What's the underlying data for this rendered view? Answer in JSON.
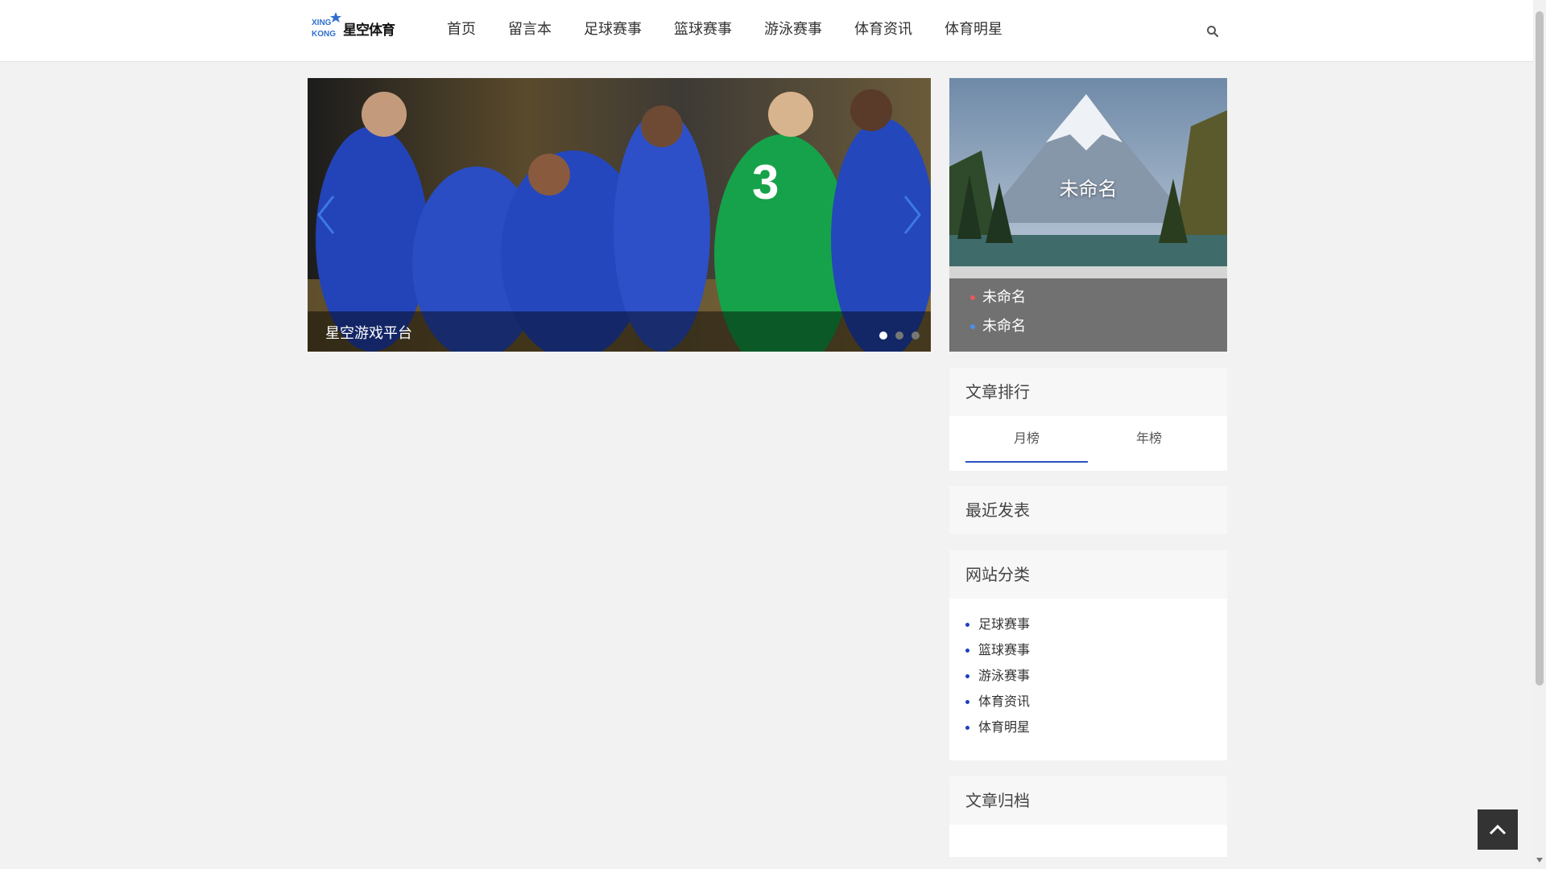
{
  "header": {
    "logo_mark": "XING KONG",
    "logo_text": "星空体育",
    "nav": [
      "首页",
      "留言本",
      "足球赛事",
      "篮球赛事",
      "游泳赛事",
      "体育资讯",
      "体育明星"
    ]
  },
  "slider": {
    "caption": "星空游戏平台",
    "slide_count": 3,
    "active_slide": 1
  },
  "feature": {
    "title": "未命名",
    "items": [
      "未命名",
      "未命名"
    ]
  },
  "ranking": {
    "title": "文章排行",
    "tabs": [
      "月榜",
      "年榜"
    ]
  },
  "recent": {
    "title": "最近发表"
  },
  "categories": {
    "title": "网站分类",
    "items": [
      "足球赛事",
      "篮球赛事",
      "游泳赛事",
      "体育资讯",
      "体育明星"
    ]
  },
  "archive": {
    "title": "文章归档"
  },
  "colors": {
    "accent": "#2b52c4",
    "bullet": "#1d3ec4",
    "back_top": "#333333"
  },
  "icons": [
    "search-icon",
    "chevron-left-icon",
    "chevron-right-icon",
    "chevron-up-icon"
  ]
}
